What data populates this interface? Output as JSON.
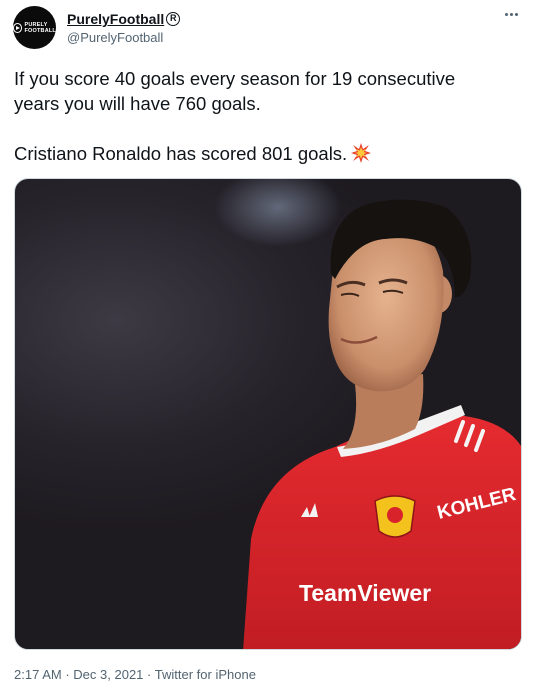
{
  "account": {
    "display_name": "PurelyFootball",
    "badge": "R",
    "handle": "@PurelyFootball",
    "avatar_logo_line1": "PURELY",
    "avatar_logo_line2": "FOOTBALL"
  },
  "tweet": {
    "text_line1": "If you score 40 goals every season for 19 consecutive",
    "text_line2": "years you will have 760 goals.",
    "text_line3": "Cristiano Ronaldo has scored 801 goals.",
    "emoji_icon": "collision-burst-icon"
  },
  "media": {
    "jersey_sponsor": "TeamViewer",
    "sleeve_sponsor": "KOHLER"
  },
  "meta": {
    "time": "2:17 AM",
    "separator": "·",
    "date": "Dec 3, 2021",
    "source": "Twitter for iPhone"
  },
  "colors": {
    "text": "#0f1419",
    "secondary": "#536471",
    "jersey_red": "#d8232a"
  }
}
